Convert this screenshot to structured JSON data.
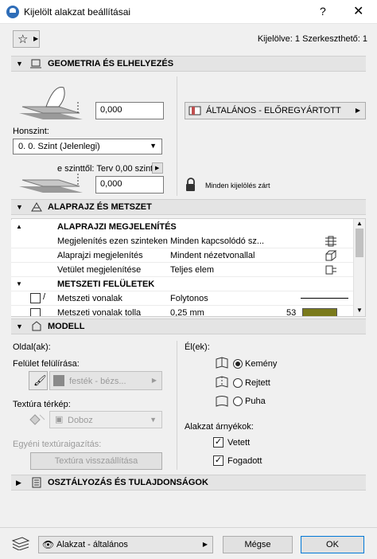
{
  "window": {
    "title": "Kijelölt alakzat beállításai",
    "help": "?",
    "close": "✕"
  },
  "header": {
    "selection_info": "Kijelölve: 1 Szerkeszthető: 1"
  },
  "geometry": {
    "title": "GEOMETRIA ÉS ELHELYEZÉS",
    "top_offset": "0,000",
    "layer_label": "ÁLTALÁNOS - ELŐREGYÁRTOTT",
    "home_story_label": "Honszint:",
    "home_story_value": "0. 0. Szint (Jelenlegi)",
    "offset_label": "e szinttől: Terv 0,00 szint",
    "bottom_offset": "0,000",
    "lock_label": "Minden kijelölés zárt"
  },
  "floorplan": {
    "title": "ALAPRAJZ ÉS METSZET",
    "group1": "ALAPRAJZI MEGJELENÍTÉS",
    "rows": [
      {
        "label": "Megjelenítés ezen szinteken",
        "value": "Minden kapcsolódó sz..."
      },
      {
        "label": "Alaprajzi megjelenítés",
        "value": "Mindent nézetvonallal"
      },
      {
        "label": "Vetület megjelenítése",
        "value": "Teljes elem"
      }
    ],
    "group2": "METSZETI FELÜLETEK",
    "rows2": [
      {
        "label": "Metszeti vonalak",
        "value": "Folytonos"
      },
      {
        "label": "Metszeti vonalak tolla",
        "value": "0,25 mm",
        "extra": "53"
      }
    ]
  },
  "model": {
    "title": "MODELL",
    "sides_label": "Oldal(ak):",
    "surface_label": "Felület felülírása:",
    "surface_value": "festék - bézs...",
    "texture_label": "Textúra térkép:",
    "texture_value": "Doboz",
    "custom_texture_label": "Egyéni textúraigazítás:",
    "reset_texture": "Textúra visszaállítása",
    "edges_label": "Él(ek):",
    "edge_options": [
      "Kemény",
      "Rejtett",
      "Puha"
    ],
    "shadows_label": "Alakzat árnyékok:",
    "shadow_options": [
      "Vetett",
      "Fogadott"
    ]
  },
  "classification": {
    "title": "OSZTÁLYOZÁS ÉS TULAJDONSÁGOK"
  },
  "footer": {
    "view_label": "Alakzat - általános",
    "cancel": "Mégse",
    "ok": "OK"
  }
}
